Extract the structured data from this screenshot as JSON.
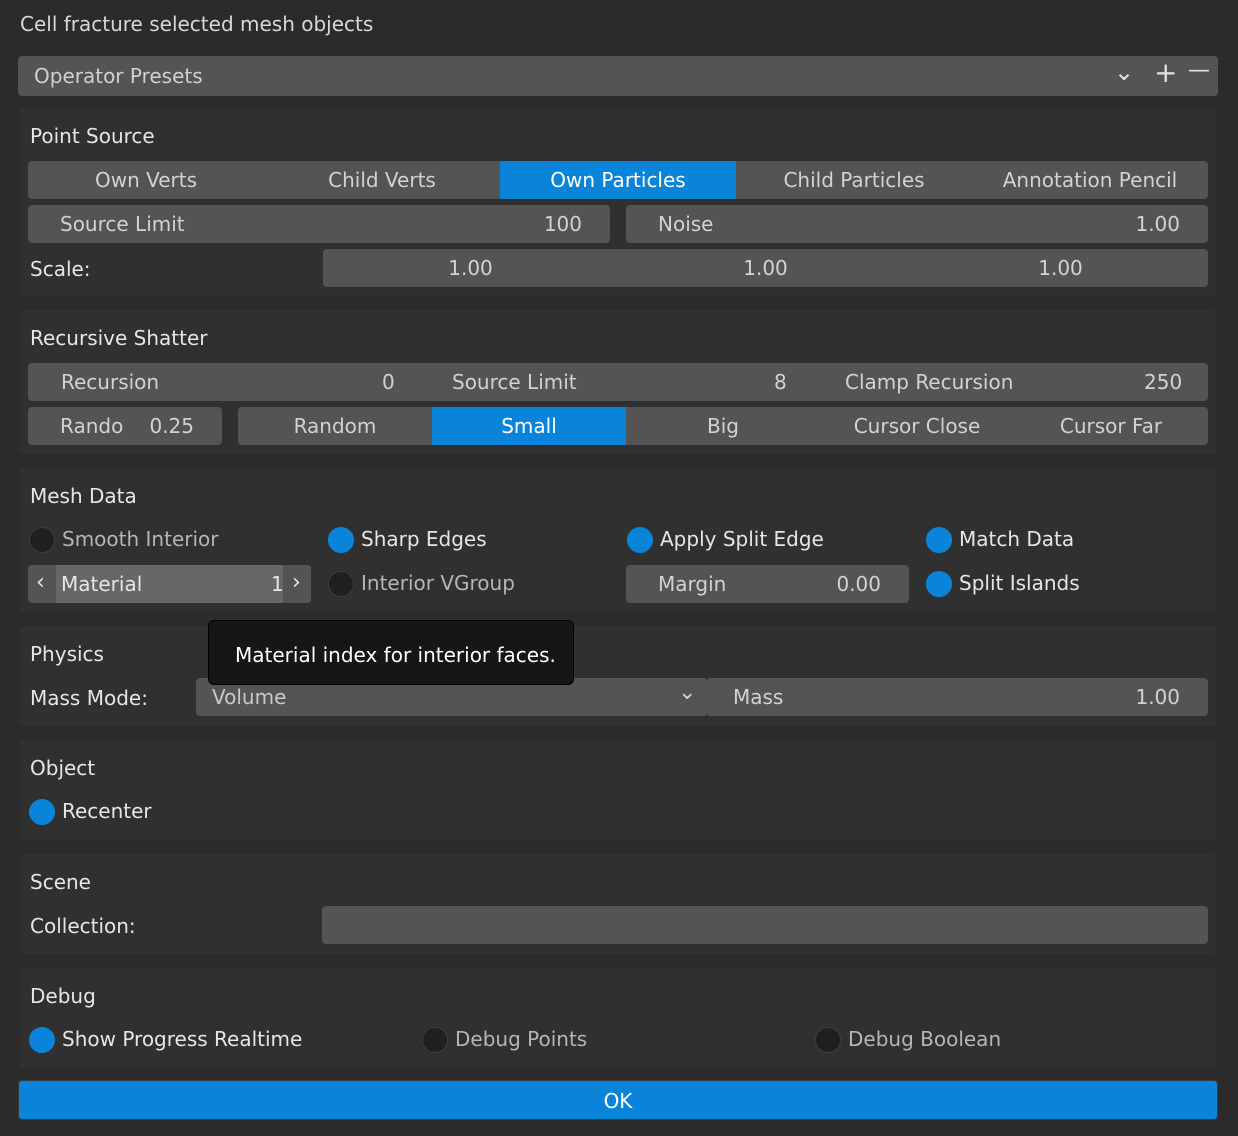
{
  "window": {
    "title": "Cell fracture selected mesh objects"
  },
  "presets": {
    "label": "Operator Presets",
    "dropdown_icon": "⌄",
    "add_icon": "+",
    "remove_icon": "—"
  },
  "point_source": {
    "heading": "Point Source",
    "modes": [
      "Own Verts",
      "Child Verts",
      "Own Particles",
      "Child Particles",
      "Annotation Pencil"
    ],
    "selected_mode": "Own Particles",
    "source_limit": {
      "label": "Source Limit",
      "value": "100"
    },
    "noise": {
      "label": "Noise",
      "value": "1.00"
    },
    "scale": {
      "label": "Scale:",
      "x": "1.00",
      "y": "1.00",
      "z": "1.00"
    }
  },
  "recursive_shatter": {
    "heading": "Recursive Shatter",
    "recursion": {
      "label": "Recursion",
      "value": "0"
    },
    "source_limit": {
      "label": "Source Limit",
      "value": "8"
    },
    "clamp": {
      "label": "Clamp Recursion",
      "value": "250"
    },
    "rando": {
      "label": "Rando",
      "value": "0.25"
    },
    "options": [
      "Random",
      "Small",
      "Big",
      "Cursor Close",
      "Cursor Far"
    ],
    "selected_option": "Small"
  },
  "mesh_data": {
    "heading": "Mesh Data",
    "smooth_interior": {
      "label": "Smooth Interior",
      "checked": false
    },
    "sharp_edges": {
      "label": "Sharp Edges",
      "checked": true
    },
    "apply_split_edge": {
      "label": "Apply Split Edge",
      "checked": true
    },
    "match_data": {
      "label": "Match Data",
      "checked": true
    },
    "material": {
      "label": "Material",
      "value": "1",
      "left_icon": "‹",
      "right_icon": "›"
    },
    "interior_vgroup": {
      "label": "Interior VGroup",
      "checked": false
    },
    "margin": {
      "label": "Margin",
      "value": "0.00"
    },
    "split_islands": {
      "label": "Split Islands",
      "checked": true
    }
  },
  "tooltip": {
    "text": "Material index for interior faces."
  },
  "physics": {
    "heading": "Physics",
    "mass_mode_label": "Mass Mode:",
    "mass_mode_value": "Volume",
    "chevron_icon": "⌄",
    "mass": {
      "label": "Mass",
      "value": "1.00"
    }
  },
  "object": {
    "heading": "Object",
    "recenter": {
      "label": "Recenter",
      "checked": true
    }
  },
  "scene": {
    "heading": "Scene",
    "collection_label": "Collection:",
    "collection_value": ""
  },
  "debug": {
    "heading": "Debug",
    "show_progress": {
      "label": "Show Progress Realtime",
      "checked": true
    },
    "debug_points": {
      "label": "Debug Points",
      "checked": false
    },
    "debug_boolean": {
      "label": "Debug Boolean",
      "checked": false
    }
  },
  "ok_button": {
    "label": "OK"
  },
  "colors": {
    "accent": "#0a84d8",
    "field": "#545454",
    "panel": "#303030",
    "background": "#2b2b2b"
  }
}
